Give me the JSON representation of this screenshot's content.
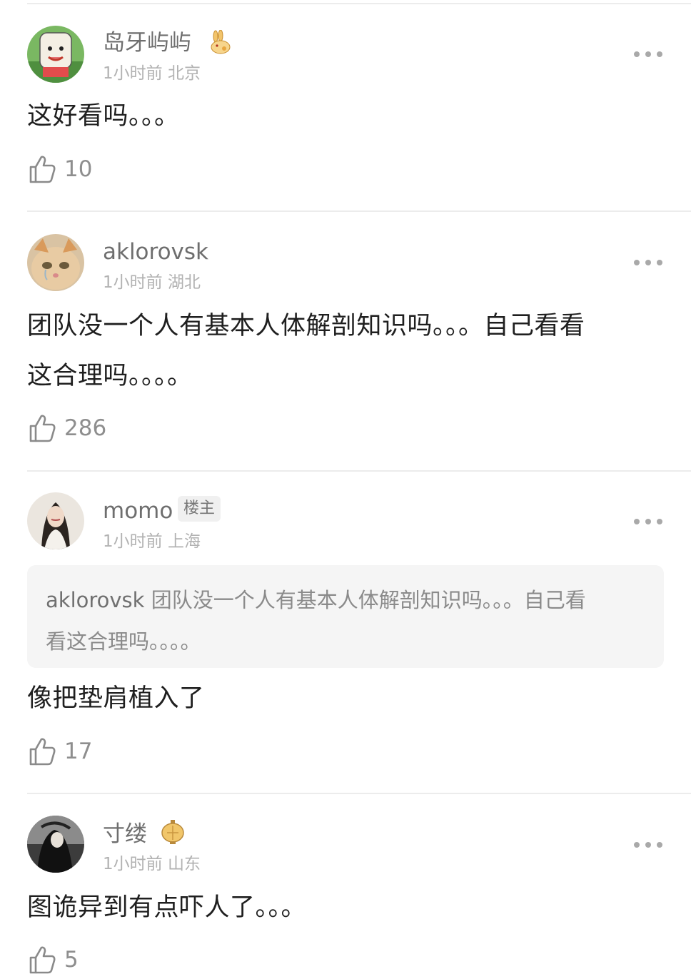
{
  "comments": [
    {
      "username": "岛牙屿屿",
      "badge_icon": "rabbit-badge-icon",
      "time": "1小时前",
      "location": "北京",
      "text": "这好看吗。。。",
      "likes": "10"
    },
    {
      "username": "aklorovsk",
      "time": "1小时前",
      "location": "湖北",
      "text_line1": "团队没一个人有基本人体解剖知识吗。。。自己看看",
      "text_line2": "这合理吗。。。。",
      "likes": "286"
    },
    {
      "username": "momo",
      "op_badge": "楼主",
      "time": "1小时前",
      "location": "上海",
      "quote_user": "aklorovsk",
      "quote_text_line1": "团队没一个人有基本人体解剖知识吗。。。自己看",
      "quote_text_line2": "看这合理吗。。。。",
      "text": "像把垫肩植入了",
      "likes": "17"
    },
    {
      "username": "寸缕",
      "badge_icon": "lantern-badge-icon",
      "time": "1小时前",
      "location": "山东",
      "text": "图诡异到有点吓人了。。。",
      "likes": "5"
    }
  ],
  "colors": {
    "text": "#1f1f1f",
    "username": "#6e6e6e",
    "meta": "#b2b2b2",
    "divider": "#ececec",
    "quote_bg": "#f5f5f5"
  }
}
